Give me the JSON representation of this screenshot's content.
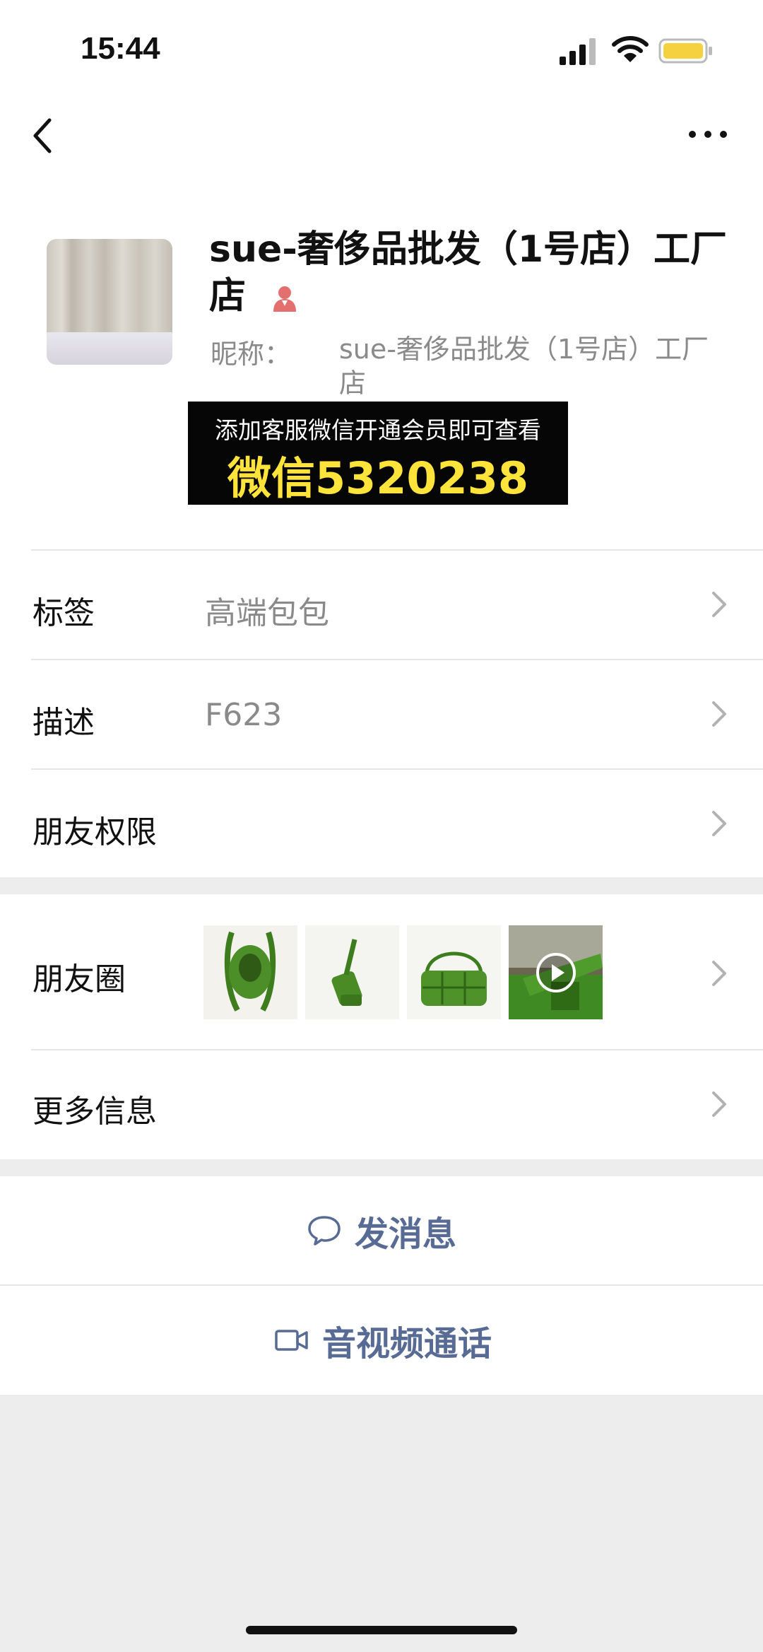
{
  "status_bar": {
    "time": "15:44"
  },
  "contact": {
    "display_name": "sue-奢侈品批发（1号店）工厂店",
    "nickname_label": "昵称：",
    "nickname_value": "sue-奢侈品批发（1号店）工厂店"
  },
  "promo": {
    "line1": "添加客服微信开通会员即可查看",
    "line2": "微信5320238"
  },
  "rows": {
    "tags": {
      "label": "标签",
      "value": "高端包包"
    },
    "description": {
      "label": "描述",
      "value": "F623"
    },
    "friend_permissions": {
      "label": "朋友权限"
    },
    "moments": {
      "label": "朋友圈"
    },
    "more_info": {
      "label": "更多信息"
    }
  },
  "actions": {
    "message": "发消息",
    "call": "音视频通话"
  },
  "icons": {
    "back": "chevron-left-icon",
    "more": "more-dots-icon",
    "gender": "female-icon",
    "message": "chat-bubble-icon",
    "call": "video-camera-icon",
    "play": "play-icon"
  },
  "colors": {
    "link_blue": "#576b95",
    "promo_yellow": "#fde33a",
    "battery_yellow": "#f5d03f",
    "female_red": "#e36f6f"
  }
}
